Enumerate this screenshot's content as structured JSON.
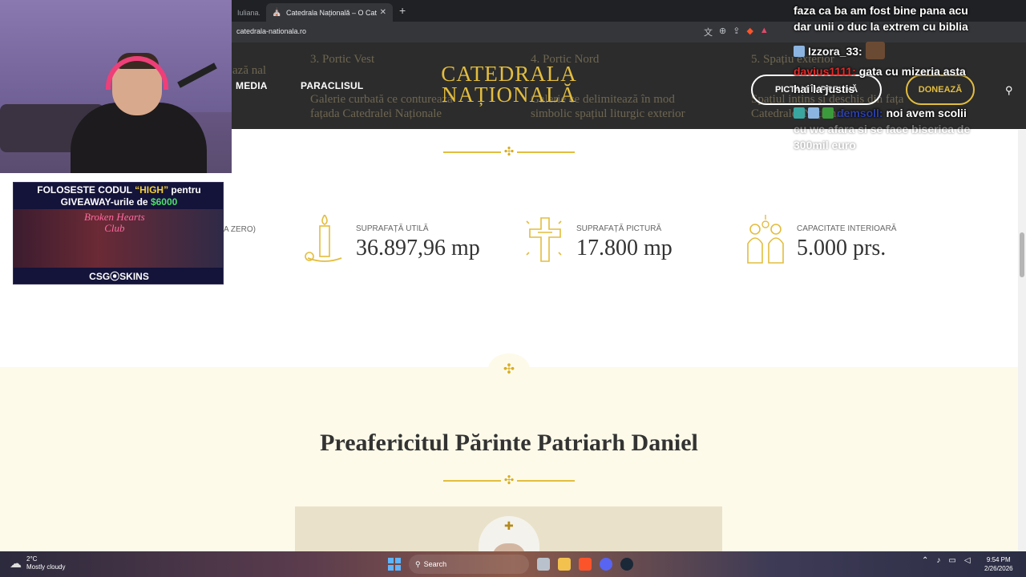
{
  "browser": {
    "prev_tab_title": "Iuliana.d",
    "active_tab_title": "Catedrala Națională – O Catedrală",
    "new_tab_symbol": "+",
    "close_symbol": "✕",
    "url": "catedrala-nationala.ro"
  },
  "header": {
    "bg_cols": [
      {
        "title": "3. Portic Vest",
        "body": "Galerie curbată ce conturează\nfațada Catedralei Naționale"
      },
      {
        "title": "4. Portic Nord",
        "body": "Galerie ce delimitează în mod\nsimbolic spațiul liturgic exterior"
      },
      {
        "title": "5. Spațiu exterior",
        "body": "Spațiul intins și deschis din fața\nCatedralei Naționale"
      }
    ],
    "bg_left_fragment": "ază\nnal",
    "nav_media": "MEDIA",
    "nav_paraclisul": "PARACLISUL",
    "logo_line1": "CATEDRALA",
    "logo_line2": "NAȚIONALĂ",
    "btn_pictam": "PICTAM ÎMPREUNĂ",
    "btn_doneaza": "DONEAZĂ"
  },
  "stats": {
    "partial_label": "A ZERO)",
    "items": [
      {
        "label": "SUPRAFAȚĂ UTILĂ",
        "value": "36.897,96 mp",
        "icon": "candle-icon"
      },
      {
        "label": "SUPRAFAȚĂ PICTURĂ",
        "value": "17.800 mp",
        "icon": "cross-icon"
      },
      {
        "label": "CAPACITATE INTERIOARĂ",
        "value": "5.000 prs.",
        "icon": "people-icon"
      }
    ]
  },
  "section": {
    "heading": "Preafericitul Părinte Patriarh Daniel"
  },
  "overlay": {
    "sponsor_line1_a": "FOLOSESTE CODUL ",
    "sponsor_code": "“HIGH”",
    "sponsor_line1_b": " pentru",
    "sponsor_line2_a": "GIVEAWAY-urile de ",
    "sponsor_amount": "$6000",
    "sponsor_art_text": "Broken Hearts\nClub",
    "sponsor_brand": "CSG⦿SKINS",
    "chat": [
      {
        "user": "",
        "text": "faza ca ba am fost bine pana acu",
        "faded": false
      },
      {
        "user": "",
        "text": "dar unii o duc la extrem cu biblia",
        "faded": false
      },
      {
        "user": "Izzora_33:",
        "text": "",
        "faded": false
      },
      {
        "user": "davius1111:",
        "text": "gata cu mizeria asta",
        "faded": false
      },
      {
        "user": "",
        "text": "hai la justis",
        "faded": false
      },
      {
        "user": "demsoll:",
        "text": "noi avem scolii",
        "faded": false
      },
      {
        "user": "",
        "text": "cu wc afara si se face biserica de",
        "faded": true
      },
      {
        "user": "",
        "text": "300mil euro",
        "faded": true
      }
    ]
  },
  "taskbar": {
    "temp": "2°C",
    "weather": "Mostly cloudy",
    "search": "Search",
    "time": "9:54 PM",
    "date": "2/26/2026"
  },
  "colors": {
    "gold": "#e3bd3e",
    "header_bg": "#2c2c2c",
    "cream": "#fdfae9"
  }
}
